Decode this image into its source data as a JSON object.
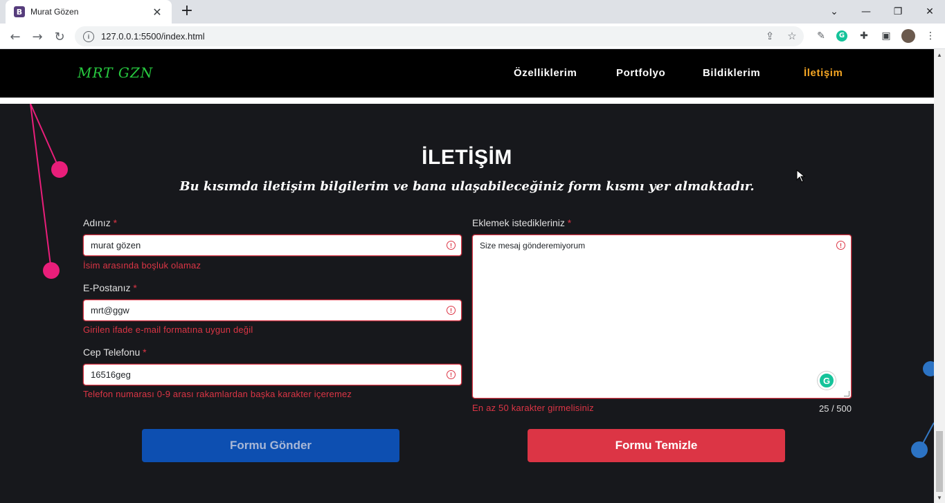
{
  "browser": {
    "tab_title": "Murat Gözen",
    "tab_favicon": "B",
    "url": "127.0.0.1:5500/index.html",
    "icons": [
      "back-icon",
      "forward-icon",
      "reload-icon",
      "info-icon",
      "share-icon",
      "star-icon",
      "extension-icon",
      "grammarly-icon",
      "puzzle-icon",
      "sidepanel-icon",
      "avatar",
      "menu-icon"
    ]
  },
  "navbar": {
    "brand": "MRT GZN",
    "links": [
      "Özelliklerim",
      "Portfolyo",
      "Bildiklerim",
      "İletişim"
    ],
    "active_link": "İletişim",
    "brand_color": "#27c93f",
    "active_color": "#f5a623"
  },
  "section": {
    "title": "İLETİŞİM",
    "subtitle": "Bu kısımda iletişim bilgilerim ve bana ulaşabileceğiniz form kısmı yer almaktadır."
  },
  "form": {
    "required_mark": "*",
    "name": {
      "label": "Adınız",
      "value": "murat gözen",
      "error": "İsim arasında boşluk olamaz"
    },
    "email": {
      "label": "E-Postanız",
      "value": "mrt@ggw",
      "error": "Girilen ifade e-mail formatına uygun değil"
    },
    "phone": {
      "label": "Cep Telefonu",
      "value": "16516geg",
      "error": "Telefon numarası 0-9 arası rakamlardan başka karakter içeremez"
    },
    "message": {
      "label": "Eklemek istedikleriniz",
      "value": "Size mesaj gönderemiyorum",
      "error": "En az 50 karakter girmelisiniz",
      "counter": "25 / 500"
    },
    "submit_label": "Formu Gönder",
    "clear_label": "Formu Temizle",
    "error_color": "#dc3545"
  }
}
